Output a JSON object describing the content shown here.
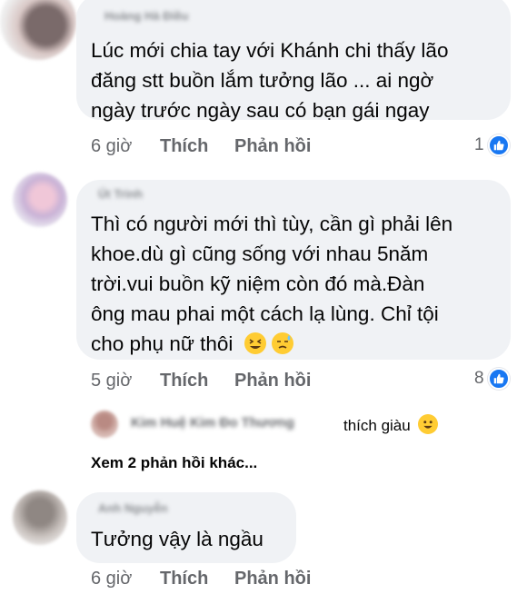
{
  "comments": [
    {
      "author": "Hoàng Hà Điều",
      "lines": [
        "Lúc mới chia tay với Khánh chi thấy lão",
        "đăng stt buồn lắm tưởng lão ... ai ngờ",
        "ngày trước ngày sau có bạn gái ngay"
      ],
      "time": "6 giờ",
      "like_label": "Thích",
      "reply_label": "Phản hồi",
      "reaction_count": "1"
    },
    {
      "author": "Út Trinh",
      "lines": [
        "Thì có người mới thì tùy, cần gì phải lên",
        "khoe.dù gì cũng sống với nhau 5năm",
        "trời.vui buồn kỹ niệm còn đó mà.Đàn",
        "ông mau phai một cách lạ lùng. Chỉ tội",
        "cho phụ nữ thôi"
      ],
      "time": "5 giờ",
      "like_label": "Thích",
      "reply_label": "Phản hồi",
      "reaction_count": "8",
      "reply_preview": {
        "author": "Kim Huệ Kim Đo Thương",
        "text": "thích giàu"
      },
      "more_replies": "Xem 2 phản hồi khác..."
    },
    {
      "author": "Anh Nguyễn",
      "lines": [
        "Tưởng vậy là ngầu"
      ],
      "time": "6 giờ",
      "like_label": "Thích",
      "reply_label": "Phản hồi"
    }
  ],
  "colors": {
    "bubble": "#f0f2f5",
    "like_blue": "#1877f2",
    "meta_gray": "#65676b"
  },
  "icons": [
    "like-icon",
    "grinning-squint-emoji",
    "sweat-emoji",
    "smile-emoji"
  ]
}
